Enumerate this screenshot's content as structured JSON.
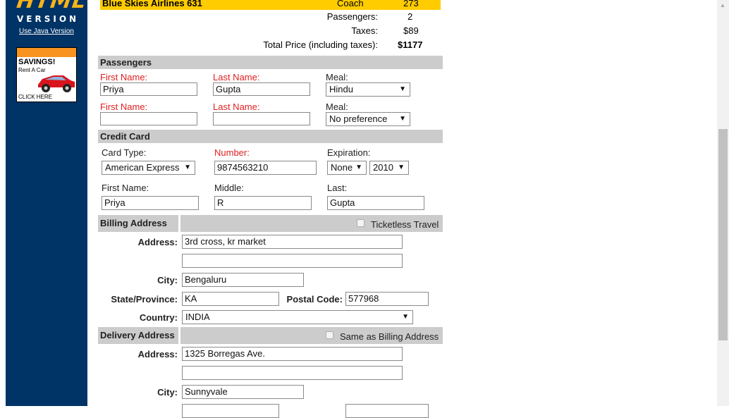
{
  "sidebar": {
    "logo_html": "HTML",
    "logo_version": "VERSION",
    "java_link": "Use Java Version",
    "ad": {
      "title": "SAVINGS!",
      "subtitle": "Rent A Car",
      "cta": "CLICK HERE"
    }
  },
  "flight": {
    "name": "Blue Skies Airlines 631",
    "class": "Coach",
    "seats": "273"
  },
  "summary": [
    {
      "label": "Passengers:",
      "value": "2"
    },
    {
      "label": "Taxes:",
      "value": "$89"
    },
    {
      "label": "Total Price (including taxes):",
      "value": "$1177"
    }
  ],
  "passengers": {
    "title": "Passengers",
    "rows": [
      {
        "first_label": "First Name:",
        "first_value": "Priya",
        "last_label": "Last Name:",
        "last_value": "Gupta",
        "meal_label": "Meal:",
        "meal_value": "Hindu"
      },
      {
        "first_label": "First Name:",
        "first_value": "",
        "last_label": "Last Name:",
        "last_value": "",
        "meal_label": "Meal:",
        "meal_value": "No preference"
      }
    ]
  },
  "credit_card": {
    "title": "Credit Card",
    "card_type_label": "Card Type:",
    "card_type_value": "American Express",
    "number_label": "Number:",
    "number_value": "9874563210",
    "expiration_label": "Expiration:",
    "exp_month": "None",
    "exp_year": "2010",
    "first_label": "First Name:",
    "first_value": "Priya",
    "middle_label": "Middle:",
    "middle_value": "R",
    "last_label": "Last:",
    "last_value": "Gupta"
  },
  "billing": {
    "title": "Billing Address",
    "ticketless_label": "Ticketless Travel",
    "address_label": "Address:",
    "address1": "3rd cross, kr market",
    "address2": "",
    "city_label": "City:",
    "city": "Bengaluru",
    "state_label": "State/Province:",
    "state": "KA",
    "postal_label": "Postal Code:",
    "postal": "577968",
    "country_label": "Country:",
    "country": "INDIA"
  },
  "delivery": {
    "title": "Delivery Address",
    "same_label": "Same as Billing Address",
    "address_label": "Address:",
    "address1": "1325 Borregas Ave.",
    "address2": "",
    "city_label": "City:",
    "city": "Sunnyvale"
  },
  "colors": {
    "sidebar": "#003366",
    "flight_bar": "#ffcc00",
    "section_bar": "#cccccc",
    "required_label": "#e02020",
    "logo": "#f7b31a"
  }
}
